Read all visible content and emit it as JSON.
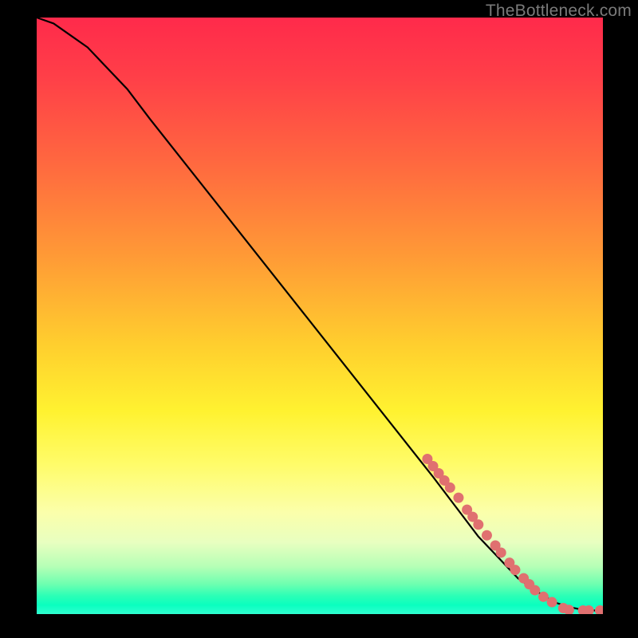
{
  "watermark": "TheBottleneck.com",
  "chart_data": {
    "type": "line",
    "title": "",
    "xlabel": "",
    "ylabel": "",
    "xlim": [
      0,
      100
    ],
    "ylim": [
      0,
      100
    ],
    "curve": {
      "name": "bottleneck-curve",
      "x": [
        0,
        3,
        6,
        9,
        12,
        16,
        20,
        25,
        30,
        35,
        40,
        45,
        50,
        55,
        60,
        65,
        70,
        74,
        78,
        82,
        85,
        88,
        90,
        92,
        94,
        96,
        98,
        100
      ],
      "y": [
        100,
        99,
        97,
        95,
        92,
        88,
        83,
        77,
        71,
        65,
        59,
        53,
        47,
        41,
        35,
        29,
        23,
        18,
        13,
        9,
        6,
        4,
        2.8,
        1.8,
        1.2,
        0.8,
        0.6,
        0.6
      ]
    },
    "markers": {
      "name": "highlighted-points",
      "color": "#e07070",
      "points": [
        {
          "x": 69.0,
          "y": 26.0
        },
        {
          "x": 70.0,
          "y": 24.8
        },
        {
          "x": 71.0,
          "y": 23.6
        },
        {
          "x": 72.0,
          "y": 22.4
        },
        {
          "x": 73.0,
          "y": 21.2
        },
        {
          "x": 74.5,
          "y": 19.5
        },
        {
          "x": 76.0,
          "y": 17.5
        },
        {
          "x": 77.0,
          "y": 16.3
        },
        {
          "x": 78.0,
          "y": 15.0
        },
        {
          "x": 79.5,
          "y": 13.2
        },
        {
          "x": 81.0,
          "y": 11.5
        },
        {
          "x": 82.0,
          "y": 10.3
        },
        {
          "x": 83.5,
          "y": 8.6
        },
        {
          "x": 84.5,
          "y": 7.4
        },
        {
          "x": 86.0,
          "y": 6.0
        },
        {
          "x": 87.0,
          "y": 5.0
        },
        {
          "x": 88.0,
          "y": 4.0
        },
        {
          "x": 89.5,
          "y": 2.9
        },
        {
          "x": 91.0,
          "y": 2.0
        },
        {
          "x": 93.0,
          "y": 1.0
        },
        {
          "x": 94.0,
          "y": 0.7
        },
        {
          "x": 96.5,
          "y": 0.6
        },
        {
          "x": 97.5,
          "y": 0.6
        },
        {
          "x": 99.5,
          "y": 0.6
        }
      ]
    }
  }
}
